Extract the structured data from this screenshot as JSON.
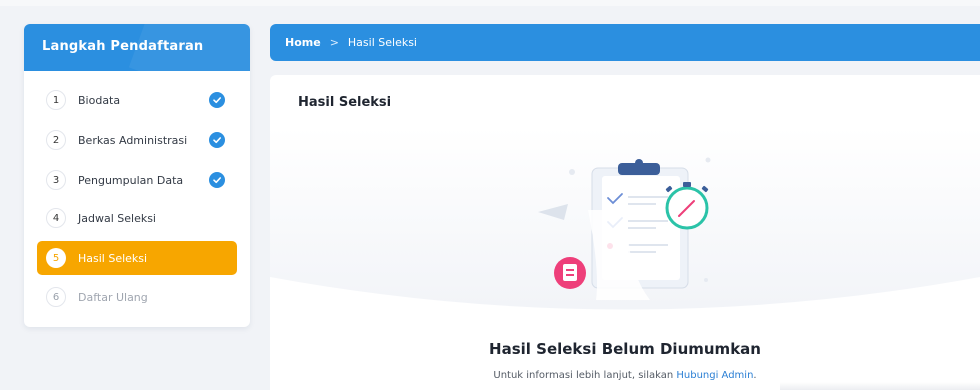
{
  "sidebar": {
    "title": "Langkah Pendaftaran",
    "steps": [
      {
        "number": "1",
        "label": "Biodata",
        "status": "done"
      },
      {
        "number": "2",
        "label": "Berkas Administrasi",
        "status": "done"
      },
      {
        "number": "3",
        "label": "Pengumpulan Data",
        "status": "done"
      },
      {
        "number": "4",
        "label": "Jadwal Seleksi",
        "status": "pending"
      },
      {
        "number": "5",
        "label": "Hasil Seleksi",
        "status": "active"
      },
      {
        "number": "6",
        "label": "Daftar Ulang",
        "status": "disabled"
      }
    ]
  },
  "breadcrumb": {
    "home": "Home",
    "separator": ">",
    "current": "Hasil Seleksi"
  },
  "main": {
    "card_title": "Hasil Seleksi",
    "empty_title": "Hasil Seleksi Belum Diumumkan",
    "empty_desc_prefix": "Untuk informasi lebih lanjut, silakan ",
    "empty_desc_link": "Hubungi Admin",
    "empty_desc_suffix": "."
  },
  "colors": {
    "primary": "#2b8fe0",
    "active_step": "#f7a600",
    "link": "#2b7fd4",
    "accent_pink": "#ee3f7a",
    "accent_teal": "#2bc3a8"
  }
}
